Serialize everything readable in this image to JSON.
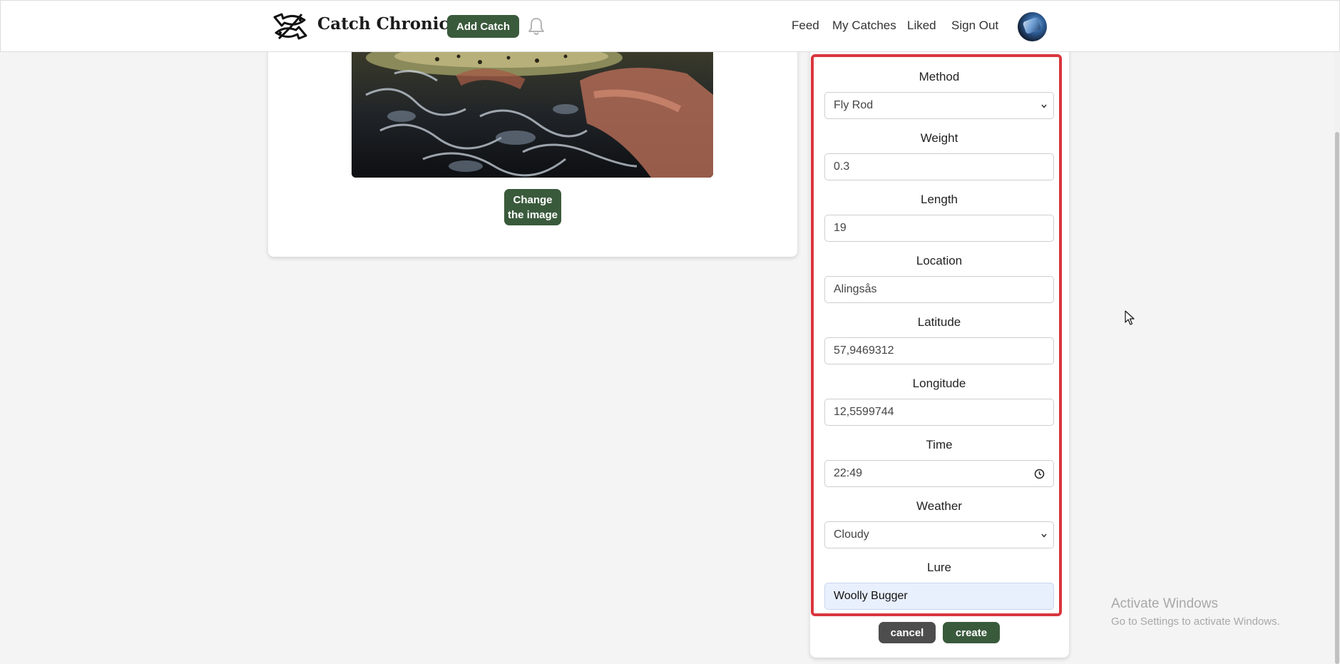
{
  "navbar": {
    "brand_name": "Catch Chronicle",
    "add_catch_label": "Add Catch",
    "links": [
      "Feed",
      "My Catches",
      "Liked",
      "Sign Out"
    ]
  },
  "image_card": {
    "change_image_label": "Change the image"
  },
  "form": {
    "fields": [
      {
        "label": "Method",
        "value": "Fly Rod",
        "type": "select"
      },
      {
        "label": "Weight",
        "value": "0.3",
        "type": "text"
      },
      {
        "label": "Length",
        "value": "19",
        "type": "text"
      },
      {
        "label": "Location",
        "value": "Alingsås",
        "type": "text"
      },
      {
        "label": "Latitude",
        "value": "57,9469312",
        "type": "text"
      },
      {
        "label": "Longitude",
        "value": "12,5599744",
        "type": "text"
      },
      {
        "label": "Time",
        "value": "22:49",
        "type": "time"
      },
      {
        "label": "Weather",
        "value": "Cloudy",
        "type": "select"
      },
      {
        "label": "Lure",
        "value": "Woolly Bugger",
        "type": "text",
        "focused": true
      }
    ],
    "cancel_label": "cancel",
    "create_label": "create"
  },
  "watermark": {
    "title": "Activate Windows",
    "subtitle": "Go to Settings to activate Windows."
  },
  "colors": {
    "primary_green": "#3a5a3c",
    "highlight_red": "#d9363e",
    "cancel_gray": "#4d4d4d",
    "focus_blue": "#e8f0fe"
  }
}
